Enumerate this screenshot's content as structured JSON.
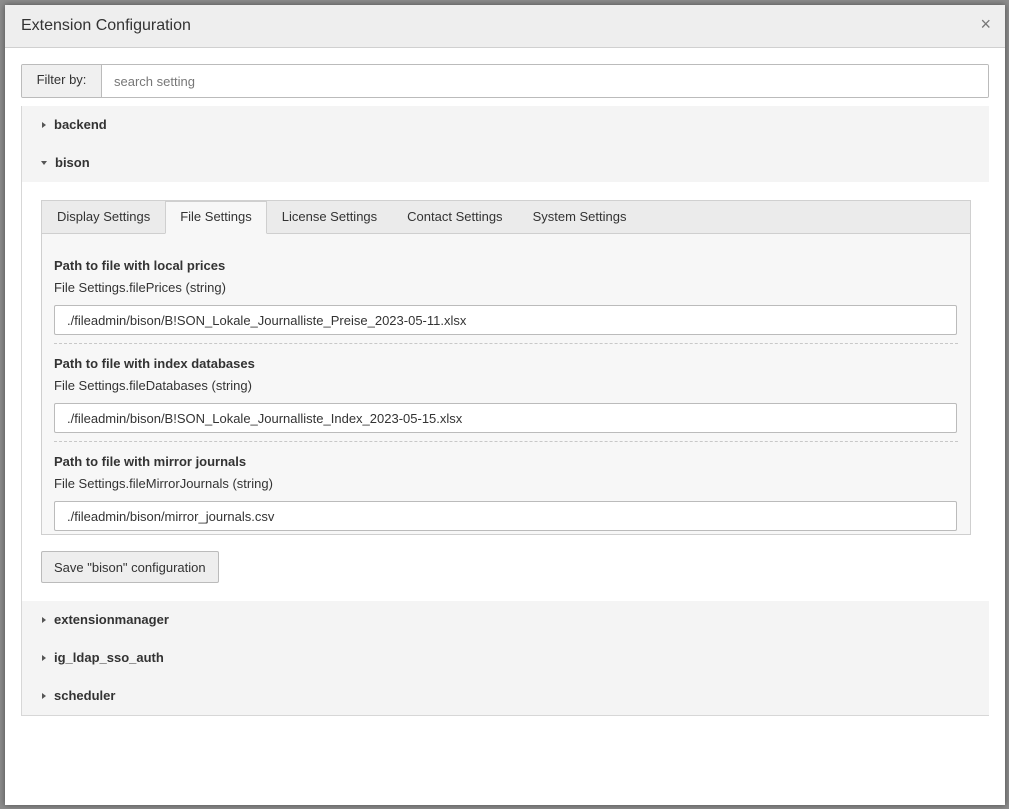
{
  "modal": {
    "title": "Extension Configuration",
    "close_label": "×"
  },
  "filter": {
    "label": "Filter by:",
    "placeholder": "search setting",
    "value": ""
  },
  "extensions": [
    {
      "name": "backend",
      "expanded": false
    },
    {
      "name": "bison",
      "expanded": true
    },
    {
      "name": "extensionmanager",
      "expanded": false
    },
    {
      "name": "ig_ldap_sso_auth",
      "expanded": false
    },
    {
      "name": "scheduler",
      "expanded": false
    }
  ],
  "bison": {
    "tabs": [
      {
        "label": "Display Settings",
        "active": false
      },
      {
        "label": "File Settings",
        "active": true
      },
      {
        "label": "License Settings",
        "active": false
      },
      {
        "label": "Contact Settings",
        "active": false
      },
      {
        "label": "System Settings",
        "active": false
      }
    ],
    "settings": [
      {
        "title": "Path to file with local prices",
        "description": "File Settings.filePrices (string)",
        "value": "./fileadmin/bison/B!SON_Lokale_Journalliste_Preise_2023-05-11.xlsx"
      },
      {
        "title": "Path to file with index databases",
        "description": "File Settings.fileDatabases (string)",
        "value": "./fileadmin/bison/B!SON_Lokale_Journalliste_Index_2023-05-15.xlsx"
      },
      {
        "title": "Path to file with mirror journals",
        "description": "File Settings.fileMirrorJournals (string)",
        "value": "./fileadmin/bison/mirror_journals.csv"
      }
    ],
    "save_label": "Save \"bison\" configuration"
  },
  "colors": {
    "header_bg": "#eeeeee",
    "panel_heading_bg": "#f4f4f4",
    "tab_content_bg": "#f7f7f7",
    "overlay": "#8c8c8c"
  }
}
